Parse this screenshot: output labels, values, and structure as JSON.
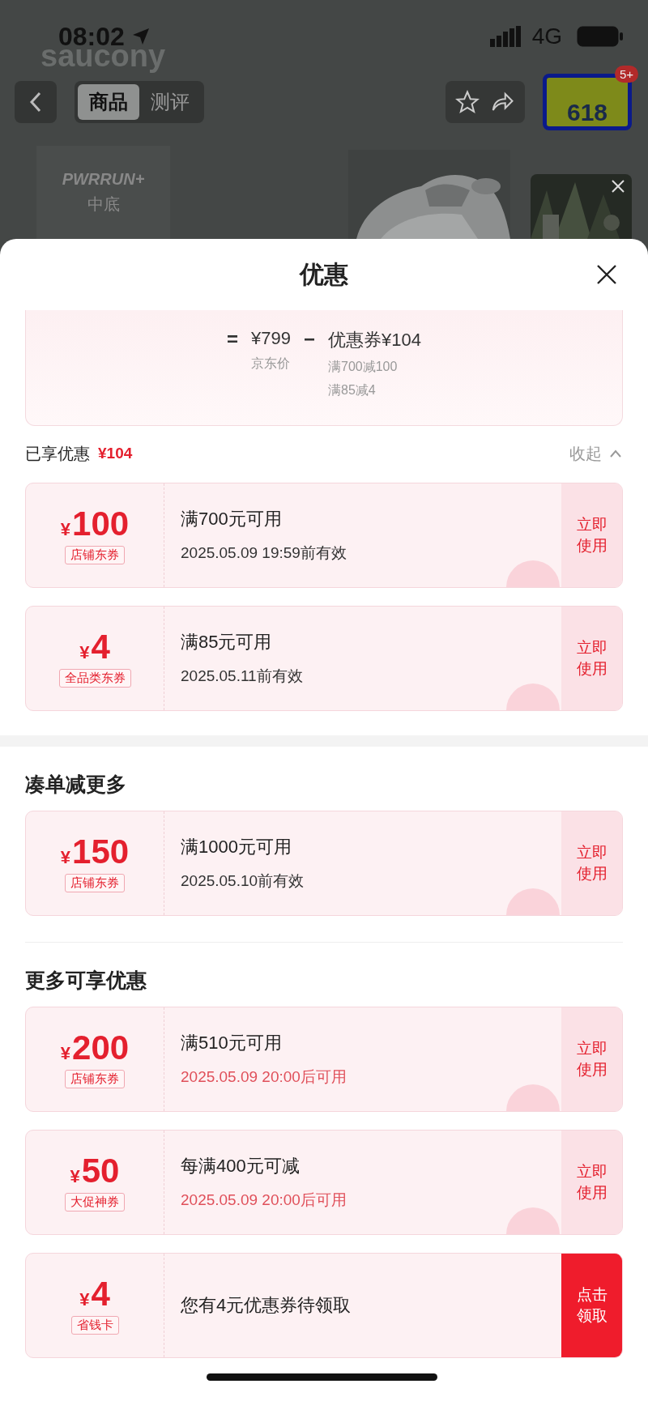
{
  "status_bar": {
    "time": "08:02",
    "network": "4G"
  },
  "product_page": {
    "brand": "saucony",
    "tabs": [
      {
        "label": "商品",
        "selected": true
      },
      {
        "label": "测评",
        "selected": false
      }
    ],
    "promo": {
      "text": "618",
      "badge": "5+"
    },
    "feature": {
      "logo": "PWRRUN+",
      "label": "中底"
    }
  },
  "sheet": {
    "title": "优惠",
    "summary": {
      "equals": "=",
      "price": "¥799",
      "minus": "−",
      "coupon": "优惠券¥104",
      "price_label": "京东价",
      "coupon_items": [
        "满700减100",
        "满85减4"
      ]
    },
    "enjoyed": {
      "label": "已享优惠",
      "amount": "¥104",
      "toggle": "收起"
    },
    "enjoyed_coupons": [
      {
        "kind": "use",
        "currency": "¥",
        "value": "100",
        "tag": "店铺东券",
        "title": "满700元可用",
        "date": "2025.05.09 19:59前有效",
        "upcoming": false,
        "action": "立即使用",
        "claimed": true
      },
      {
        "kind": "use",
        "currency": "¥",
        "value": "4",
        "tag": "全品类东券",
        "title": "满85元可用",
        "date": "2025.05.11前有效",
        "upcoming": false,
        "action": "立即使用",
        "claimed": true
      }
    ],
    "sections": [
      {
        "title": "凑单减更多",
        "coupons": [
          {
            "kind": "use",
            "currency": "¥",
            "value": "150",
            "tag": "店铺东券",
            "title": "满1000元可用",
            "date": "2025.05.10前有效",
            "upcoming": false,
            "action": "立即使用",
            "claimed": true
          }
        ]
      },
      {
        "title": "更多可享优惠",
        "coupons": [
          {
            "kind": "use",
            "currency": "¥",
            "value": "200",
            "tag": "店铺东券",
            "title": "满510元可用",
            "date": "2025.05.09 20:00后可用",
            "upcoming": true,
            "action": "立即使用",
            "claimed": true
          },
          {
            "kind": "use",
            "currency": "¥",
            "value": "50",
            "tag": "大促神券",
            "title": "每满400元可减",
            "date": "2025.05.09 20:00后可用",
            "upcoming": true,
            "action": "立即使用",
            "claimed": true
          },
          {
            "kind": "claim",
            "currency": "¥",
            "value": "4",
            "tag": "省钱卡",
            "title": "您有4元优惠券待领取",
            "action": "点击领取",
            "claimed": false
          }
        ]
      }
    ]
  }
}
